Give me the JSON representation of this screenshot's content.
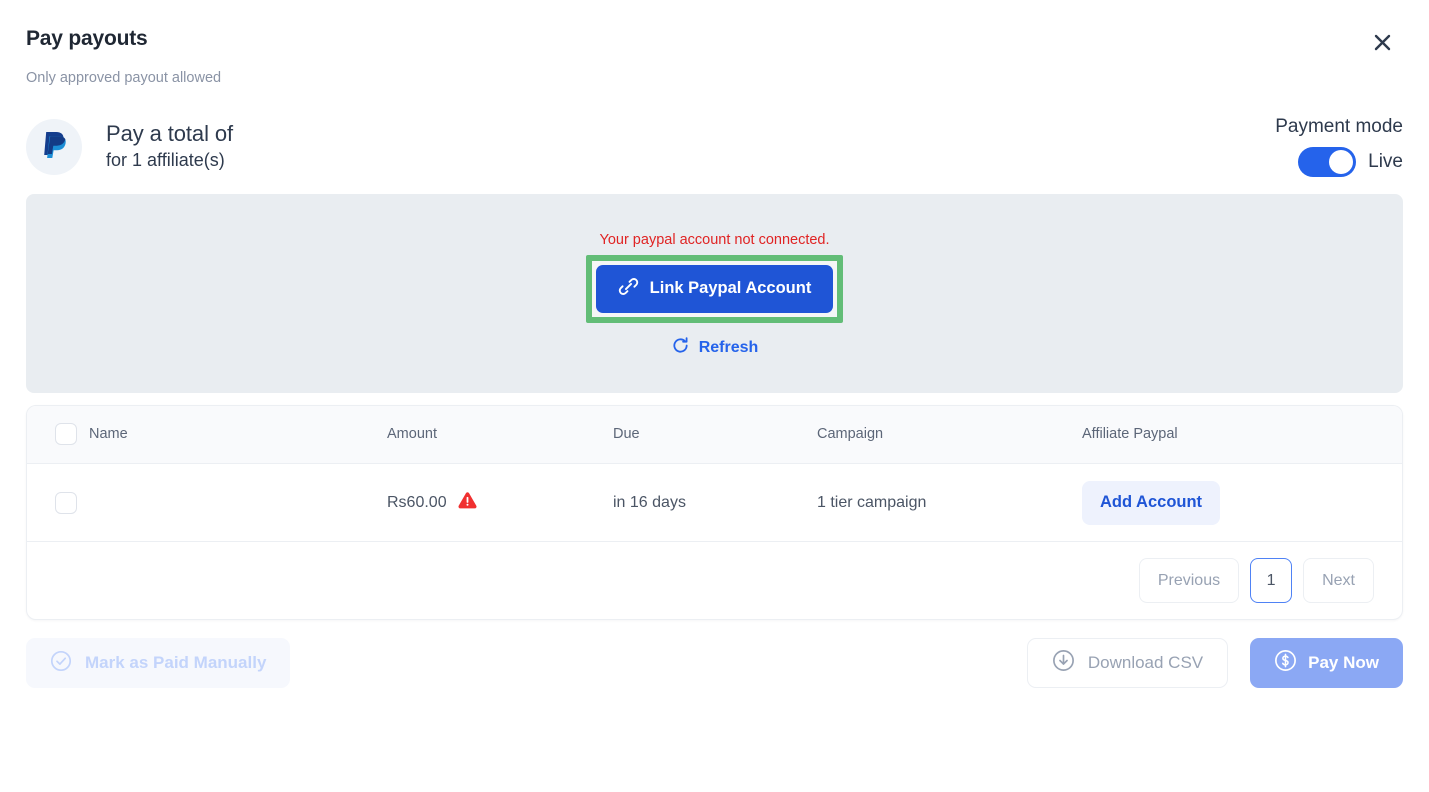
{
  "header": {
    "title": "Pay payouts",
    "subtitle": "Only approved payout allowed",
    "close_icon": "close-icon"
  },
  "summary": {
    "brand_icon": "paypal-icon",
    "main_text": "Pay a total of",
    "sub_text": "for 1 affiliate(s)"
  },
  "payment_mode": {
    "label": "Payment mode",
    "toggle_state": "on",
    "value": "Live"
  },
  "connect_banner": {
    "warning_text": "Your paypal account not connected.",
    "link_button_label": "Link Paypal Account",
    "link_icon": "link-icon",
    "refresh_label": "Refresh",
    "refresh_icon": "refresh-icon",
    "highlight_color": "#62bd77",
    "banner_bg": "#e9edf1"
  },
  "table": {
    "columns": [
      "",
      "Name",
      "Amount",
      "Due",
      "Campaign",
      "Affiliate Paypal"
    ],
    "rows": [
      {
        "selected": false,
        "name": "",
        "amount": "Rs60.00",
        "amount_warning_icon": "warning-triangle-icon",
        "due": "in 16 days",
        "campaign": "1 tier campaign",
        "paypal_action": "Add Account"
      }
    ]
  },
  "pagination": {
    "previous_label": "Previous",
    "current_page": "1",
    "next_label": "Next"
  },
  "footer": {
    "mark_paid_label": "Mark as Paid Manually",
    "mark_paid_icon": "check-circle-icon",
    "download_csv_label": "Download CSV",
    "download_icon": "download-circle-icon",
    "pay_now_label": "Pay Now",
    "pay_now_icon": "dollar-circle-icon"
  },
  "colors": {
    "accent_blue": "#1f55d6",
    "link_blue": "#2563eb",
    "danger_red": "#e02424",
    "highlight_green": "#62bd77",
    "muted_text": "#98a2b3"
  }
}
